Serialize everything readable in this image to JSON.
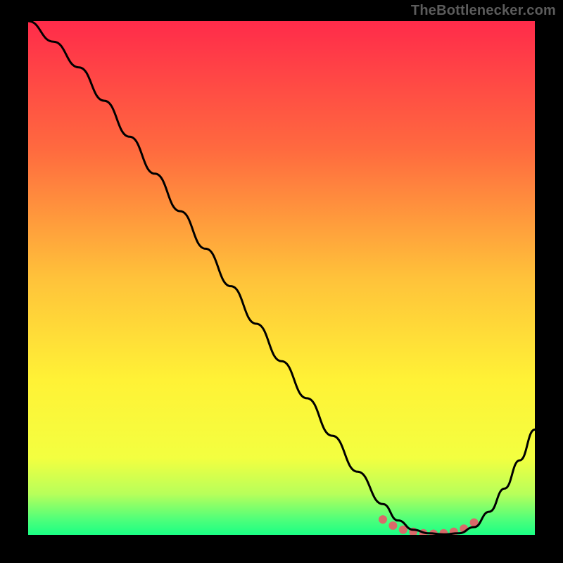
{
  "watermark": "TheBottlenecker.com",
  "chart_data": {
    "type": "line",
    "title": "",
    "xlabel": "",
    "ylabel": "",
    "xlim": [
      0,
      100
    ],
    "ylim": [
      0,
      100
    ],
    "x": [
      0,
      5,
      10,
      15,
      20,
      25,
      30,
      35,
      40,
      45,
      50,
      55,
      60,
      65,
      70,
      73,
      76,
      79,
      82,
      85,
      88,
      91,
      94,
      97,
      100
    ],
    "values": [
      100,
      96,
      91,
      84.5,
      77.5,
      70.3,
      63,
      55.7,
      48.4,
      41.1,
      33.8,
      26.6,
      19.3,
      12.3,
      6.0,
      2.8,
      1.0,
      0.3,
      0.1,
      0.3,
      1.5,
      4.5,
      9.0,
      14.5,
      20.5
    ],
    "markers": {
      "x": [
        70,
        72,
        74,
        76,
        78,
        80,
        82,
        84,
        86,
        88
      ],
      "values": [
        3.0,
        1.8,
        1.0,
        0.6,
        0.3,
        0.2,
        0.3,
        0.6,
        1.2,
        2.4
      ]
    },
    "gradient_stops": [
      {
        "offset": 0.0,
        "color": "#ff2b4a"
      },
      {
        "offset": 0.25,
        "color": "#ff6a3f"
      },
      {
        "offset": 0.5,
        "color": "#ffc23a"
      },
      {
        "offset": 0.7,
        "color": "#fff236"
      },
      {
        "offset": 0.85,
        "color": "#f3ff40"
      },
      {
        "offset": 0.92,
        "color": "#b8ff5a"
      },
      {
        "offset": 0.97,
        "color": "#4fff7a"
      },
      {
        "offset": 1.0,
        "color": "#1aff84"
      }
    ],
    "marker_color": "#d96a6a",
    "marker_radius": 6,
    "line_color": "#000000",
    "line_width": 3
  }
}
